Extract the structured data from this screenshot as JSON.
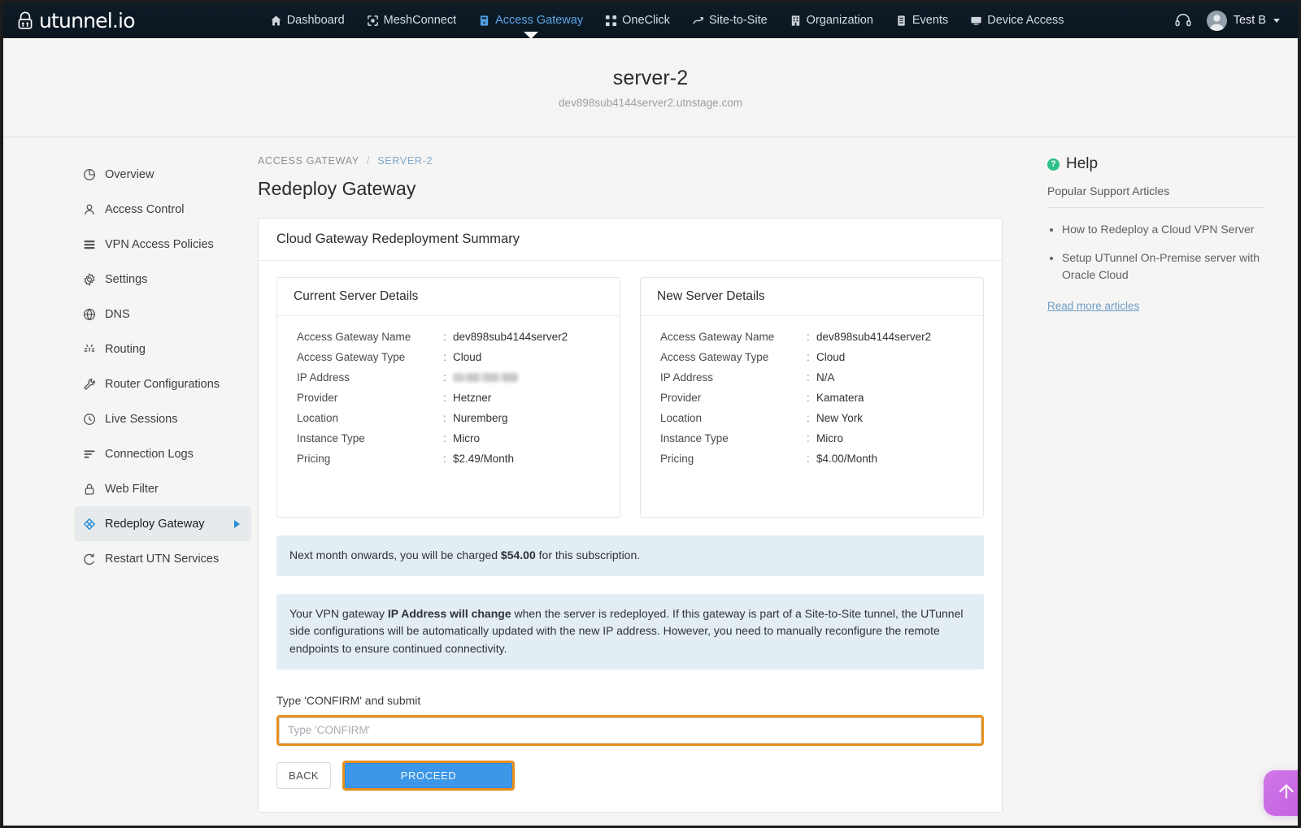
{
  "topnav": {
    "logo_text": "utunnel.io",
    "items": [
      {
        "label": "Dashboard",
        "icon": "home-icon",
        "active": false
      },
      {
        "label": "MeshConnect",
        "icon": "mesh-icon",
        "active": false
      },
      {
        "label": "Access Gateway",
        "icon": "gateway-icon",
        "active": true
      },
      {
        "label": "OneClick",
        "icon": "oneclick-icon",
        "active": false
      },
      {
        "label": "Site-to-Site",
        "icon": "site-to-site-icon",
        "active": false
      },
      {
        "label": "Organization",
        "icon": "organization-icon",
        "active": false
      },
      {
        "label": "Events",
        "icon": "events-icon",
        "active": false
      },
      {
        "label": "Device Access",
        "icon": "device-access-icon",
        "active": false
      }
    ],
    "support_icon": "headset-icon",
    "user_name": "Test B"
  },
  "page_header": {
    "title": "server-2",
    "subtitle": "dev898sub4144server2.utnstage.com"
  },
  "sidebar": {
    "items": [
      {
        "label": "Overview",
        "icon": "pie-chart-icon"
      },
      {
        "label": "Access Control",
        "icon": "user-icon"
      },
      {
        "label": "VPN Access Policies",
        "icon": "list-icon"
      },
      {
        "label": "Settings",
        "icon": "gear-icon"
      },
      {
        "label": "DNS",
        "icon": "globe-icon"
      },
      {
        "label": "Routing",
        "icon": "routing-icon"
      },
      {
        "label": "Router Configurations",
        "icon": "wrench-icon"
      },
      {
        "label": "Live Sessions",
        "icon": "clock-icon"
      },
      {
        "label": "Connection Logs",
        "icon": "logs-icon"
      },
      {
        "label": "Web Filter",
        "icon": "lock-icon"
      },
      {
        "label": "Redeploy Gateway",
        "icon": "redeploy-icon",
        "active": true
      },
      {
        "label": "Restart UTN Services",
        "icon": "restart-icon"
      }
    ]
  },
  "breadcrumb": {
    "root": "ACCESS GATEWAY",
    "separator": "/",
    "current": "SERVER-2"
  },
  "main": {
    "page_title": "Redeploy Gateway",
    "card_title": "Cloud Gateway Redeployment Summary",
    "current_server": {
      "heading": "Current Server Details",
      "rows": [
        {
          "key": "Access Gateway Name",
          "value": "dev898sub4144server2"
        },
        {
          "key": "Access Gateway Type",
          "value": "Cloud"
        },
        {
          "key": "IP Address",
          "value": "",
          "redacted": true
        },
        {
          "key": "Provider",
          "value": "Hetzner"
        },
        {
          "key": "Location",
          "value": "Nuremberg"
        },
        {
          "key": "Instance Type",
          "value": "Micro"
        },
        {
          "key": "Pricing",
          "value": "$2.49/Month"
        }
      ]
    },
    "new_server": {
      "heading": "New Server Details",
      "rows": [
        {
          "key": "Access Gateway Name",
          "value": "dev898sub4144server2"
        },
        {
          "key": "Access Gateway Type",
          "value": "Cloud"
        },
        {
          "key": "IP Address",
          "value": "N/A"
        },
        {
          "key": "Provider",
          "value": "Kamatera"
        },
        {
          "key": "Location",
          "value": "New York"
        },
        {
          "key": "Instance Type",
          "value": "Micro"
        },
        {
          "key": "Pricing",
          "value": "$4.00/Month"
        }
      ]
    },
    "billing_alert": {
      "before": "Next month onwards, you will be charged ",
      "amount": "$54.00",
      "after": " for this subscription."
    },
    "ip_alert": {
      "before": "Your VPN gateway ",
      "bold": "IP Address will change",
      "after": " when the server is redeployed. If this gateway is part of a Site-to-Site tunnel, the UTunnel side configurations will be automatically updated with the new IP address. However, you need to manually reconfigure the remote endpoints to ensure continued connectivity."
    },
    "confirm_label": "Type 'CONFIRM' and submit",
    "confirm_placeholder": "Type 'CONFIRM'",
    "confirm_value": "",
    "back_label": "BACK",
    "proceed_label": "PROCEED"
  },
  "help": {
    "title": "Help",
    "subtitle": "Popular Support Articles",
    "articles": [
      "How to Redeploy a Cloud VPN Server",
      "Setup UTunnel On-Premise server with Oracle Cloud"
    ],
    "read_more": "Read more articles"
  },
  "fab": {
    "icon": "arrow-up-icon"
  },
  "colors": {
    "nav_background": "#0d1b26",
    "nav_active": "#5aa7e8",
    "accent_orange": "#e8901c",
    "primary_blue": "#3d97e8",
    "alert_background": "#e3edf4",
    "help_green": "#2ec18a",
    "fab_purple": "#c45fe0"
  }
}
